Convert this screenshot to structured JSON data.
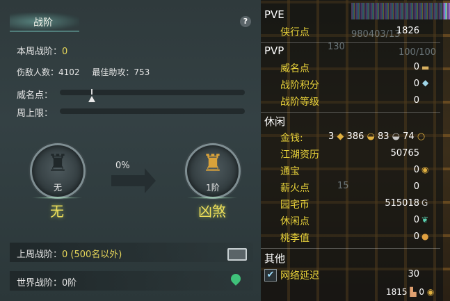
{
  "left": {
    "tab_label": "战阶",
    "help": "?",
    "week_rank": {
      "label": "本周战阶：",
      "value": "0"
    },
    "kills": {
      "label": "伤敌人数：",
      "value": "4102"
    },
    "best_assist": {
      "label": "最佳助攻：",
      "value": "753"
    },
    "prestige": {
      "label": "威名点：",
      "progress": 0.1
    },
    "week_cap": {
      "label": "周上限：",
      "progress": 0
    },
    "current_rank": {
      "level": "无",
      "name": "无"
    },
    "progress_pct": "0%",
    "next_rank": {
      "level": "1阶",
      "name": "凶煞"
    },
    "last_week": {
      "label": "上周战阶：",
      "value": "0 (500名以外)"
    },
    "world_rank": {
      "label": "世界战阶：",
      "value": "0阶"
    }
  },
  "right": {
    "pve": {
      "title": "PVE",
      "items": [
        {
          "label": "侠行点",
          "value": "1826"
        }
      ]
    },
    "pvp": {
      "title": "PVP",
      "items": [
        {
          "label": "威名点",
          "value": "0"
        },
        {
          "label": "战阶积分",
          "value": "0"
        },
        {
          "label": "战阶等级",
          "value": "0"
        }
      ]
    },
    "leisure": {
      "title": "休闲",
      "money": {
        "label": "金钱:",
        "gold": "3",
        "silver": "386",
        "copper": "83",
        "coin": "74"
      },
      "items": [
        {
          "label": "江湖资历",
          "value": "50765"
        },
        {
          "label": "通宝",
          "value": "0"
        },
        {
          "label": "薪火点",
          "value": "0"
        },
        {
          "label": "园宅币",
          "value": "515018"
        },
        {
          "label": "休闲点",
          "value": "0"
        },
        {
          "label": "桃李值",
          "value": "0"
        }
      ]
    },
    "other": {
      "title": "其他",
      "latency": {
        "label": "网络延迟",
        "value": "30"
      }
    },
    "footer": {
      "value1": "1815",
      "value2": "0"
    },
    "background_text": {
      "a": "980403/13",
      "b": "130",
      "c": "15",
      "d": "100/100"
    }
  }
}
